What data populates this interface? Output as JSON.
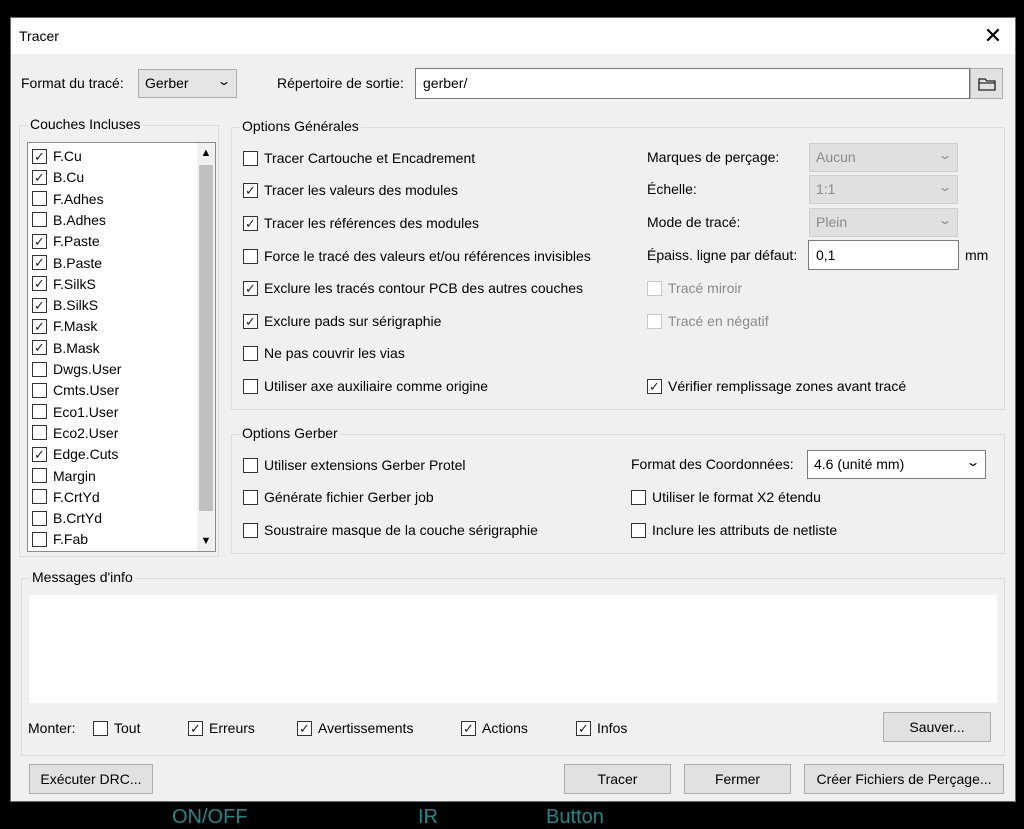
{
  "window": {
    "title": "Tracer",
    "close": "✕"
  },
  "format": {
    "label": "Format du tracé:",
    "value": "Gerber"
  },
  "output": {
    "label": "Répertoire de sortie:",
    "value": "gerber/"
  },
  "layers": {
    "title": "Couches Incluses",
    "items": [
      {
        "label": "F.Cu",
        "mark": "✓"
      },
      {
        "label": "B.Cu",
        "mark": "✓"
      },
      {
        "label": "F.Adhes",
        "mark": ""
      },
      {
        "label": "B.Adhes",
        "mark": ""
      },
      {
        "label": "F.Paste",
        "mark": "✓"
      },
      {
        "label": "B.Paste",
        "mark": "✓"
      },
      {
        "label": "F.SilkS",
        "mark": "✓"
      },
      {
        "label": "B.SilkS",
        "mark": "✓"
      },
      {
        "label": "F.Mask",
        "mark": "✓"
      },
      {
        "label": "B.Mask",
        "mark": "✓"
      },
      {
        "label": "Dwgs.User",
        "mark": ""
      },
      {
        "label": "Cmts.User",
        "mark": ""
      },
      {
        "label": "Eco1.User",
        "mark": ""
      },
      {
        "label": "Eco2.User",
        "mark": ""
      },
      {
        "label": "Edge.Cuts",
        "mark": "✓"
      },
      {
        "label": "Margin",
        "mark": ""
      },
      {
        "label": "F.CrtYd",
        "mark": ""
      },
      {
        "label": "B.CrtYd",
        "mark": ""
      },
      {
        "label": "F.Fab",
        "mark": ""
      }
    ],
    "scroll_up": "▲",
    "scroll_down": "▼"
  },
  "general": {
    "title": "Options Générales",
    "options": [
      {
        "label": "Tracer Cartouche et Encadrement",
        "mark": ""
      },
      {
        "label": "Tracer les valeurs des modules",
        "mark": "✓"
      },
      {
        "label": "Tracer les références des modules",
        "mark": "✓"
      },
      {
        "label": "Force le tracé des valeurs et/ou références invisibles",
        "mark": ""
      },
      {
        "label": "Exclure les tracés contour PCB des autres couches",
        "mark": "✓"
      },
      {
        "label": "Exclure pads sur sérigraphie",
        "mark": "✓"
      },
      {
        "label": "Ne pas couvrir les vias",
        "mark": ""
      },
      {
        "label": "Utiliser axe auxiliaire comme origine",
        "mark": ""
      }
    ],
    "drill_marks": {
      "label": "Marques de perçage:",
      "value": "Aucun"
    },
    "scale": {
      "label": "Échelle:",
      "value": "1:1"
    },
    "plot_mode": {
      "label": "Mode de tracé:",
      "value": "Plein"
    },
    "line_width": {
      "label": "Épaiss. ligne par défaut:",
      "value": "0,1",
      "unit": "mm"
    },
    "mirror": {
      "label": "Tracé miroir",
      "mark": ""
    },
    "negative": {
      "label": "Tracé en négatif",
      "mark": ""
    },
    "check_zones": {
      "label": "Vérifier remplissage zones avant tracé",
      "mark": "✓"
    }
  },
  "gerber": {
    "title": "Options Gerber",
    "protel": {
      "label": "Utiliser extensions Gerber Protel",
      "mark": ""
    },
    "job": {
      "label": "Générate fichier Gerber job",
      "mark": ""
    },
    "subtract": {
      "label": "Soustraire masque de la couche sérigraphie",
      "mark": ""
    },
    "coord": {
      "label": "Format des Coordonnées:",
      "value": "4.6 (unité mm)"
    },
    "x2": {
      "label": "Utiliser le format X2 étendu",
      "mark": ""
    },
    "netlist": {
      "label": "Inclure les attributs de netliste",
      "mark": ""
    }
  },
  "messages": {
    "title": "Messages d'info",
    "show_label": "Monter:",
    "filters": [
      {
        "label": "Tout",
        "mark": ""
      },
      {
        "label": "Erreurs",
        "mark": "✓"
      },
      {
        "label": "Avertissements",
        "mark": "✓"
      },
      {
        "label": "Actions",
        "mark": "✓"
      },
      {
        "label": "Infos",
        "mark": "✓"
      }
    ],
    "save": "Sauver..."
  },
  "buttons": {
    "drc": "Exécuter DRC...",
    "plot": "Tracer",
    "close": "Fermer",
    "drill": "Créer Fichiers de Perçage..."
  },
  "background": {
    "text1": "ON/OFF",
    "text2": "IR",
    "text3": "Button"
  },
  "icons": {
    "folder": "folder-icon",
    "dropdown": "chevron-down-icon"
  },
  "colors": {
    "check_border": "#333333",
    "window_bg": "#f0f0f0",
    "pcb_silk": "#1d8a8a"
  }
}
